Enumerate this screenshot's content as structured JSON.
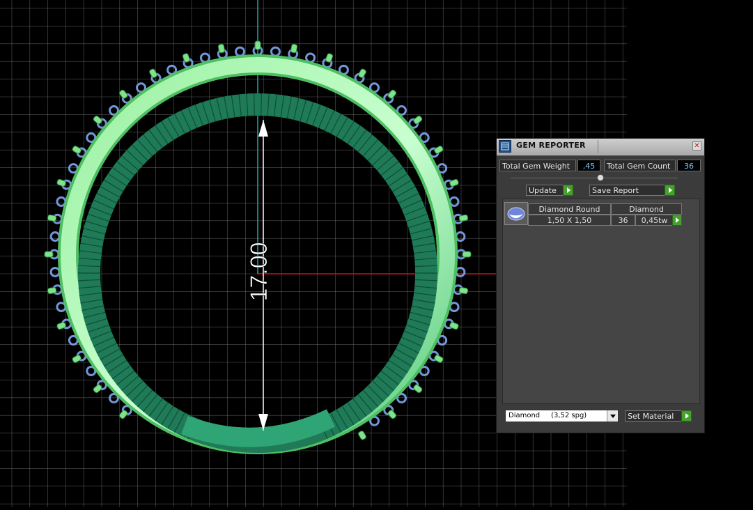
{
  "viewport": {
    "dimension_value": "17.00",
    "colors": {
      "background": "#000000",
      "grid": "#7a7a7a",
      "vertical_axis": "#1aa9b8",
      "horizontal_axis": "#c0161b",
      "shank_light": "#7fe38a",
      "shank_dark": "#25805d",
      "gem_halo": "#7ea6f0"
    }
  },
  "panel": {
    "title": "GEM REPORTER",
    "close_icon": "close-icon",
    "total_weight_label": "Total Gem Weight",
    "total_weight_value": ",45",
    "total_count_label": "Total Gem Count",
    "total_count_value": "36",
    "update_label": "Update",
    "save_report_label": "Save Report",
    "gem_row": {
      "icon": "gem-icon",
      "shape_header": "Diamond Round",
      "size": "1,50 X 1,50",
      "material_header": "Diamond",
      "count": "36",
      "weight": "0,45tw"
    },
    "material_select": "Diamond     (3,52 spg)",
    "set_material_label": "Set Material"
  }
}
